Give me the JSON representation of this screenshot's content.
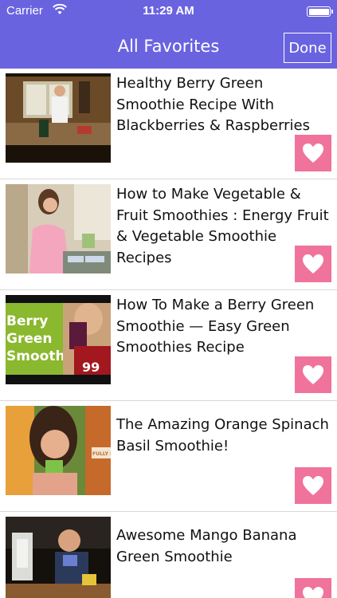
{
  "status_bar": {
    "carrier": "Carrier",
    "time": "11:29 AM",
    "battery_level": 1.0,
    "wifi_icon": "wifi-icon",
    "battery_icon": "battery-icon"
  },
  "nav": {
    "title": "All Favorites",
    "done_label": "Done"
  },
  "colors": {
    "nav_bg": "#6a63e0",
    "favorite_button": "#f0739b"
  },
  "favorites": [
    {
      "title": "Healthy Berry Green Smoothie Recipe With Blackberries & Raspberries",
      "thumbnail_text": ""
    },
    {
      "title": "How to Make Vegetable & Fruit Smoothies : Energy Fruit & Vegetable Smoothie Recipes",
      "thumbnail_text": ""
    },
    {
      "title": "How To Make a Berry Green Smoothie — Easy Green Smoothies Recipe",
      "thumbnail_text": "Berry Green Smoothie"
    },
    {
      "title": "The Amazing Orange Spinach Basil Smoothie!",
      "thumbnail_text": "FULLY RAW"
    },
    {
      "title": "Awesome Mango Banana Green Smoothie",
      "thumbnail_text": ""
    }
  ]
}
